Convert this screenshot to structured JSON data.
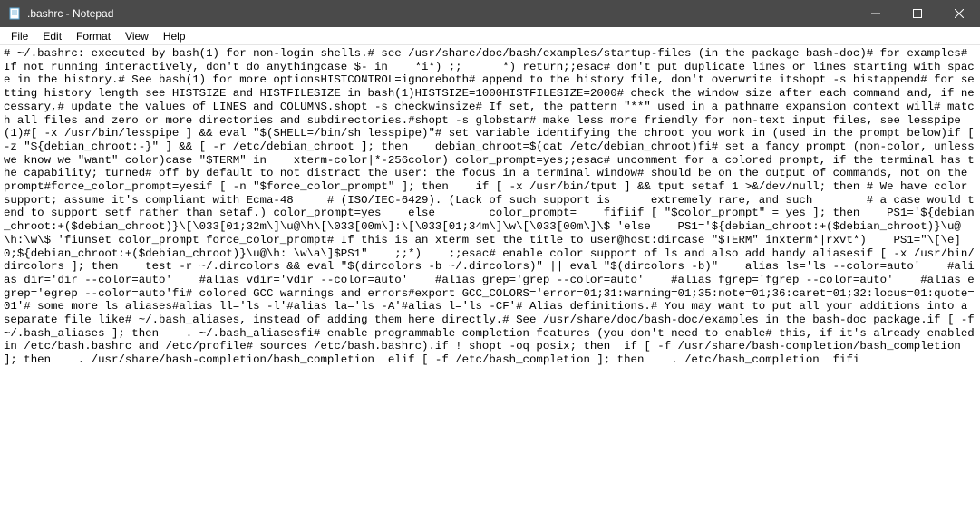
{
  "window": {
    "title": ".bashrc - Notepad"
  },
  "menu": {
    "file": "File",
    "edit": "Edit",
    "format": "Format",
    "view": "View",
    "help": "Help"
  },
  "content": "# ~/.bashrc: executed by bash(1) for non-login shells.# see /usr/share/doc/bash/examples/startup-files (in the package bash-doc)# for examples# If not running interactively, don't do anythingcase $- in    *i*) ;;      *) return;;esac# don't put duplicate lines or lines starting with space in the history.# See bash(1) for more optionsHISTCONTROL=ignoreboth# append to the history file, don't overwrite itshopt -s histappend# for setting history length see HISTSIZE and HISTFILESIZE in bash(1)HISTSIZE=1000HISTFILESIZE=2000# check the window size after each command and, if necessary,# update the values of LINES and COLUMNS.shopt -s checkwinsize# If set, the pattern \"**\" used in a pathname expansion context will# match all files and zero or more directories and subdirectories.#shopt -s globstar# make less more friendly for non-text input files, see lesspipe(1)#[ -x /usr/bin/lesspipe ] && eval \"$(SHELL=/bin/sh lesspipe)\"# set variable identifying the chroot you work in (used in the prompt below)if [ -z \"${debian_chroot:-}\" ] && [ -r /etc/debian_chroot ]; then    debian_chroot=$(cat /etc/debian_chroot)fi# set a fancy prompt (non-color, unless we know we \"want\" color)case \"$TERM\" in    xterm-color|*-256color) color_prompt=yes;;esac# uncomment for a colored prompt, if the terminal has the capability; turned# off by default to not distract the user: the focus in a terminal window# should be on the output of commands, not on the prompt#force_color_prompt=yesif [ -n \"$force_color_prompt\" ]; then    if [ -x /usr/bin/tput ] && tput setaf 1 >&/dev/null; then\t# We have color support; assume it's compliant with Ecma-48\t# (ISO/IEC-6429). (Lack of such support is\textremely rare, and such\t# a case would tend to support setf rather than setaf.)\tcolor_prompt=yes    else\tcolor_prompt=    fifiif [ \"$color_prompt\" = yes ]; then    PS1='${debian_chroot:+($debian_chroot)}\\[\\033[01;32m\\]\\u@\\h\\[\\033[00m\\]:\\[\\033[01;34m\\]\\w\\[\\033[00m\\]\\$ 'else    PS1='${debian_chroot:+($debian_chroot)}\\u@\\h:\\w\\$ 'fiunset color_prompt force_color_prompt# If this is an xterm set the title to user@host:dircase \"$TERM\" inxterm*|rxvt*)    PS1=\"\\[\\e]0;${debian_chroot:+($debian_chroot)}\\u@\\h: \\w\\a\\]$PS1\"    ;;*)    ;;esac# enable color support of ls and also add handy aliasesif [ -x /usr/bin/dircolors ]; then    test -r ~/.dircolors && eval \"$(dircolors -b ~/.dircolors)\" || eval \"$(dircolors -b)\"    alias ls='ls --color=auto'    #alias dir='dir --color=auto'    #alias vdir='vdir --color=auto'    #alias grep='grep --color=auto'    #alias fgrep='fgrep --color=auto'    #alias egrep='egrep --color=auto'fi# colored GCC warnings and errors#export GCC_COLORS='error=01;31:warning=01;35:note=01;36:caret=01;32:locus=01:quote=01'# some more ls aliases#alias ll='ls -l'#alias la='ls -A'#alias l='ls -CF'# Alias definitions.# You may want to put all your additions into a separate file like# ~/.bash_aliases, instead of adding them here directly.# See /usr/share/doc/bash-doc/examples in the bash-doc package.if [ -f ~/.bash_aliases ]; then    . ~/.bash_aliasesfi# enable programmable completion features (you don't need to enable# this, if it's already enabled in /etc/bash.bashrc and /etc/profile# sources /etc/bash.bashrc).if ! shopt -oq posix; then  if [ -f /usr/share/bash-completion/bash_completion ]; then    . /usr/share/bash-completion/bash_completion  elif [ -f /etc/bash_completion ]; then    . /etc/bash_completion  fifi"
}
